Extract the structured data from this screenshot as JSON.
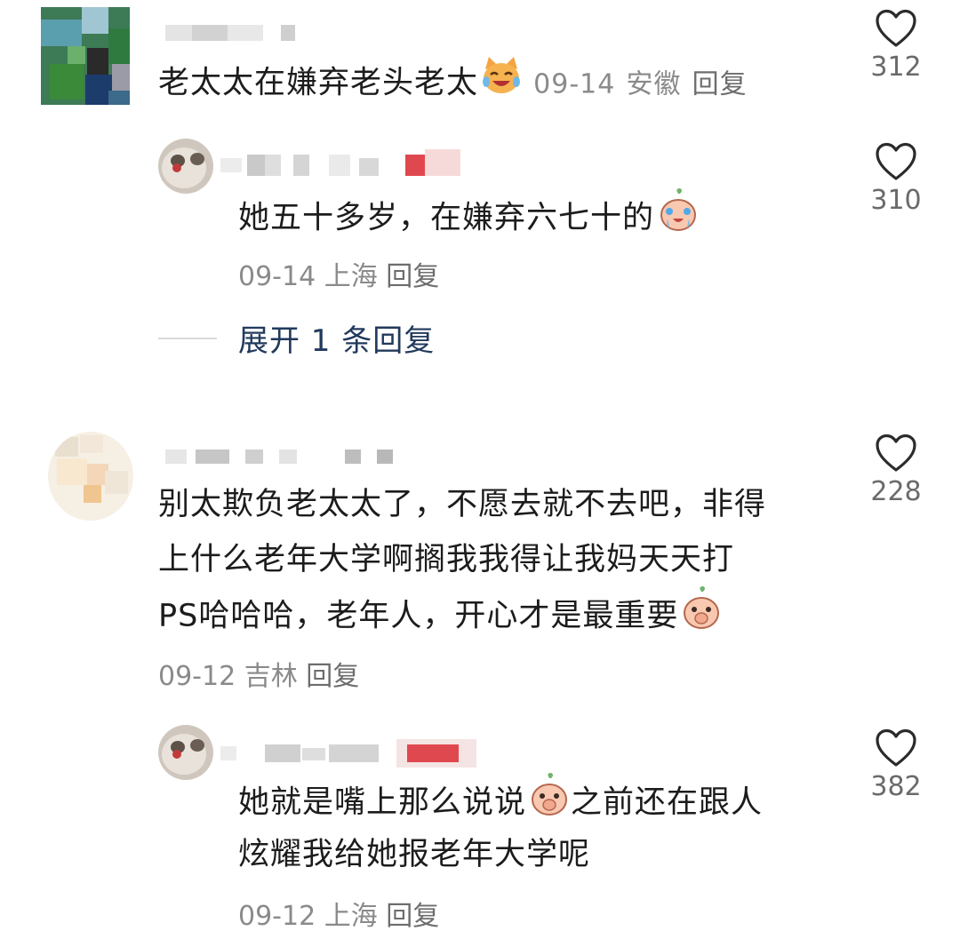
{
  "comments": [
    {
      "text": "老太太在嫌弃老头老太",
      "date": "09-14",
      "location": "安徽",
      "reply_label": "回复",
      "likes": "312",
      "emoji": "laughing-cat-emoji"
    },
    {
      "text": "她五十多岁，在嫌弃六七十的",
      "date": "09-14",
      "location": "上海",
      "reply_label": "回复",
      "likes": "310",
      "emoji": "crying-peach-emoji"
    },
    {
      "expand_label": "展开 1 条回复"
    },
    {
      "lines": [
        "别太欺负老太太了，不愿去就不去吧，非得",
        "上什么老年大学啊搁我我得让我妈天天打",
        "PS哈哈哈，老年人，开心才是最重要"
      ],
      "date": "09-12",
      "location": "吉林",
      "reply_label": "回复",
      "likes": "228",
      "emoji": "shy-peach-emoji"
    },
    {
      "line1_a": "她就是嘴上那么说说",
      "line1_b": "之前还在跟人",
      "line2": "炫耀我给她报老年大学呢",
      "date": "09-12",
      "location": "上海",
      "reply_label": "回复",
      "likes": "382",
      "emoji": "shy-peach-emoji"
    }
  ],
  "colors": {
    "text": "#1c1c1c",
    "meta": "#8a8a8a",
    "expand": "#213a5c",
    "badge_red": "#e0484f"
  }
}
